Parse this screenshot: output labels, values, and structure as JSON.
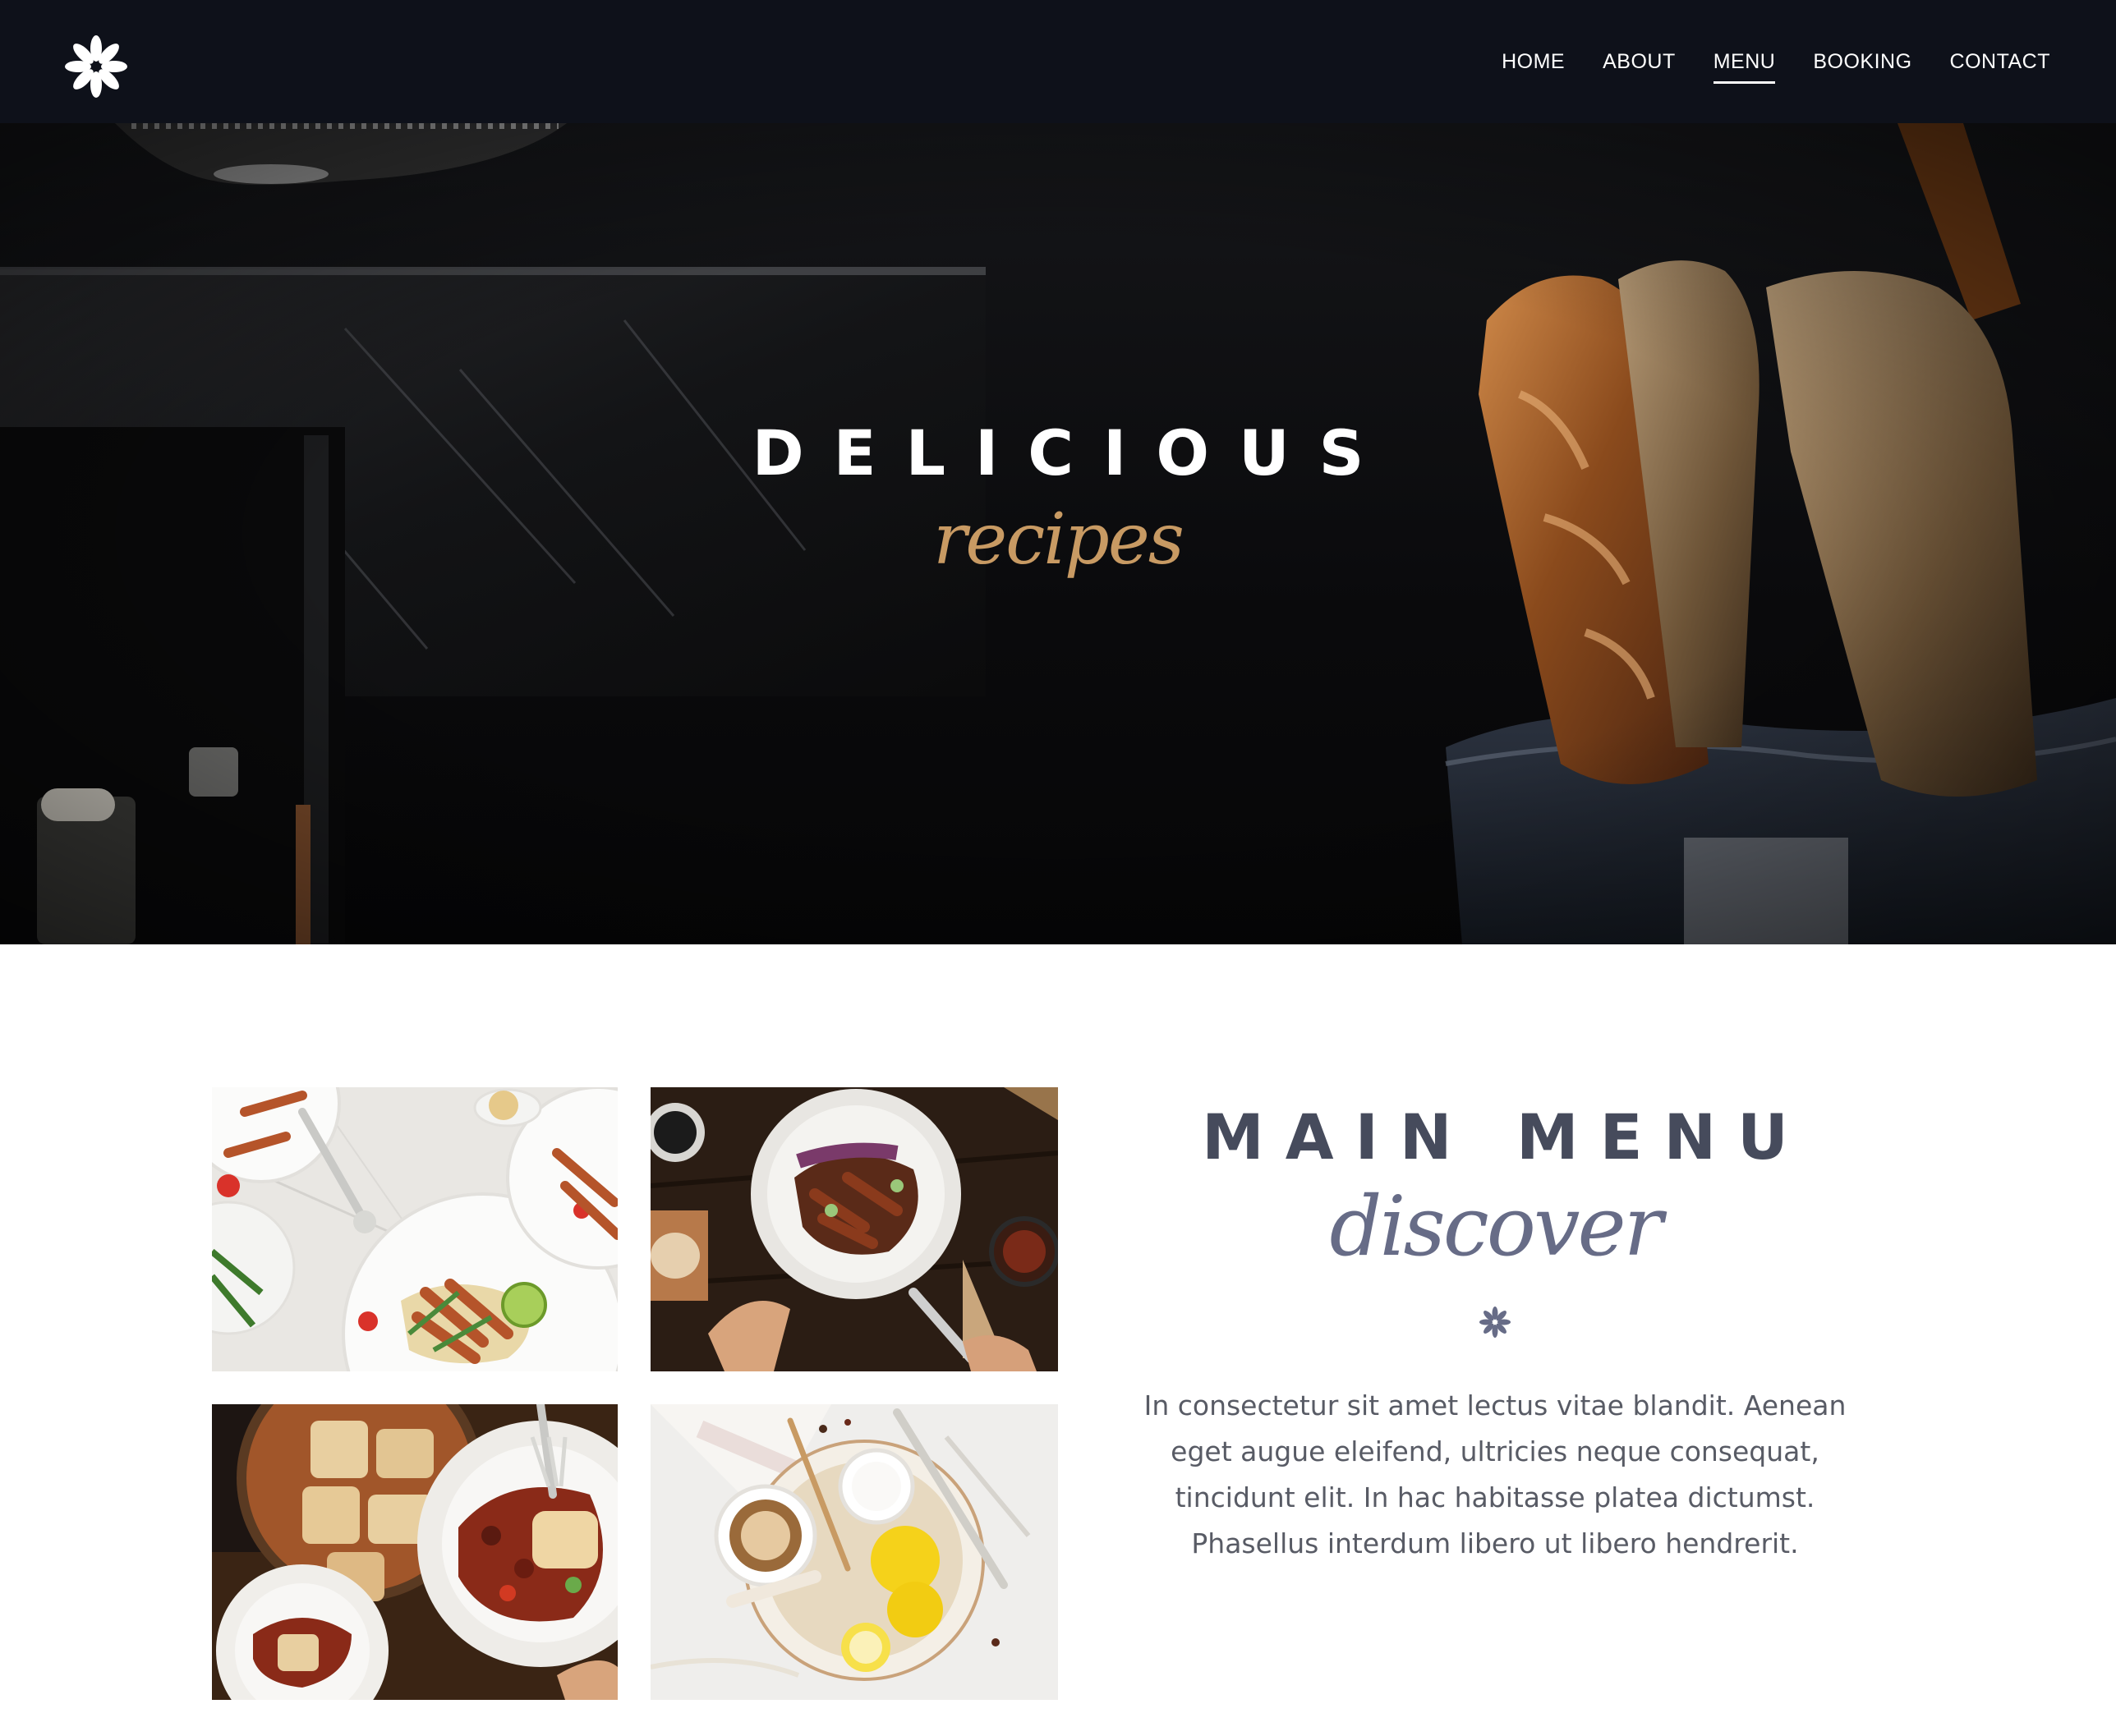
{
  "logo": {
    "icon": "asterisk-flower-icon"
  },
  "nav": {
    "items": [
      {
        "label": "HOME",
        "active": false
      },
      {
        "label": "ABOUT",
        "active": false
      },
      {
        "label": "MENU",
        "active": true
      },
      {
        "label": "BOOKING",
        "active": false
      },
      {
        "label": "CONTACT",
        "active": false
      }
    ]
  },
  "hero": {
    "title": "DELICIOUS",
    "script": "recipes",
    "accent_color": "#c89a63"
  },
  "main_menu": {
    "title": "MAIN MENU",
    "script": "discover",
    "divider_icon": "asterisk-icon",
    "body": "In consectetur sit amet lectus vitae blandit. Aenean eget augue eleifend, ultricies neque consequat, tincidunt elit. In hac habitasse platea dictumst. Phasellus interdum libero ut libero hendrerit."
  },
  "gallery": {
    "images": [
      "salad-plates-photo",
      "steak-bowl-photo",
      "bean-stew-photo",
      "lemon-dessert-photo"
    ]
  },
  "colors": {
    "nav_bg": "#0e111a",
    "heading": "#464b5c",
    "script": "#676c87",
    "body_text": "#585b65"
  }
}
